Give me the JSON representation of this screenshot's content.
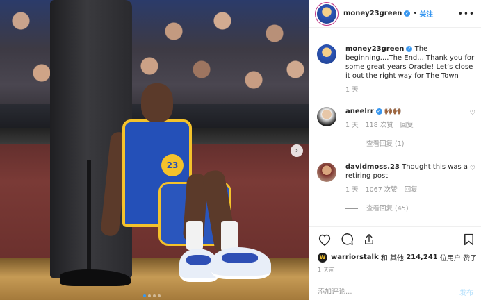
{
  "header": {
    "username": "money23green",
    "follow_label": "关注",
    "separator": "•",
    "more": "•••"
  },
  "caption": {
    "username": "money23green",
    "text": "The beginning....The End... Thank you for some great years Oracle! Let’s close it out the right way for The Town",
    "time": "1 天"
  },
  "comments": [
    {
      "username": "aneelrr",
      "text": "🙌🏾🙌🏾",
      "time": "1 天",
      "likes": "118 次赞",
      "reply": "回复",
      "view_replies": "查看回复 (1)"
    },
    {
      "username": "davidmoss.23",
      "text": "Thought this was a retiring post",
      "time": "1 天",
      "likes": "1067 次赞",
      "reply": "回复",
      "view_replies": "查看回复 (45)"
    }
  ],
  "likes": {
    "liker": "warriorstalk",
    "text_mid": " 和 其他 ",
    "count": "214,241",
    "text_end": " 位用户 赞了",
    "mini_avatar_letter": "W"
  },
  "posted_ago": "1 天前",
  "composer": {
    "placeholder": "添加评论...",
    "post_label": "发布"
  },
  "photo": {
    "jersey_number": "23",
    "next_arrow": "›"
  },
  "icons": [
    "heart-icon",
    "comment-icon",
    "share-icon",
    "bookmark-icon"
  ],
  "colors": {
    "link_blue": "#3897f0",
    "warriors_blue": "#2450b8",
    "warriors_gold": "#f4c22b"
  }
}
